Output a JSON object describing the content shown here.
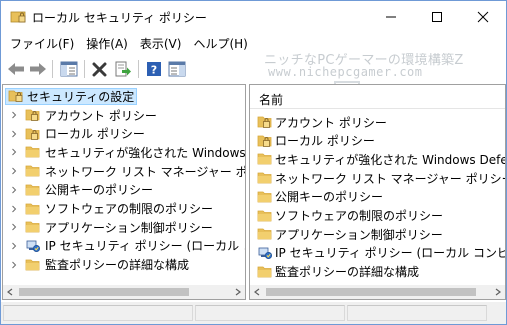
{
  "window": {
    "title": "ローカル セキュリティ ポリシー",
    "accent_color": "#6f9ad6"
  },
  "menu": {
    "items": [
      "ファイル(F)",
      "操作(A)",
      "表示(V)",
      "ヘルプ(H)"
    ]
  },
  "toolbar": {
    "buttons": [
      "back-arrow-icon",
      "forward-arrow-icon",
      "show-hide-console-tree-icon",
      "delete-icon",
      "export-list-icon",
      "help-icon",
      "show-action-pane-icon"
    ]
  },
  "watermark": {
    "line1": "ニッチなPCゲーマーの環境構築Z",
    "line2": "www.nichepcgamer.com"
  },
  "tree": {
    "root": "セキュリティの設定",
    "items": [
      {
        "label": "アカウント ポリシー",
        "icon": "locked-folder-icon"
      },
      {
        "label": "ローカル ポリシー",
        "icon": "locked-folder-icon"
      },
      {
        "label": "セキュリティが強化された Windows Defender",
        "icon": "folder-icon"
      },
      {
        "label": "ネットワーク リスト マネージャー ポリシー",
        "icon": "folder-icon"
      },
      {
        "label": "公開キーのポリシー",
        "icon": "folder-icon"
      },
      {
        "label": "ソフトウェアの制限のポリシー",
        "icon": "folder-icon"
      },
      {
        "label": "アプリケーション制御ポリシー",
        "icon": "folder-icon"
      },
      {
        "label": "IP セキュリティ ポリシー (ローカル コンピューター)",
        "icon": "ip-security-icon"
      },
      {
        "label": "監査ポリシーの詳細な構成",
        "icon": "folder-icon"
      }
    ]
  },
  "list": {
    "column_header": "名前",
    "items": [
      {
        "label": "アカウント ポリシー",
        "icon": "locked-folder-icon"
      },
      {
        "label": "ローカル ポリシー",
        "icon": "locked-folder-icon"
      },
      {
        "label": "セキュリティが強化された Windows Defender...",
        "icon": "folder-icon"
      },
      {
        "label": "ネットワーク リスト マネージャー ポリシー",
        "icon": "folder-icon"
      },
      {
        "label": "公開キーのポリシー",
        "icon": "folder-icon"
      },
      {
        "label": "ソフトウェアの制限のポリシー",
        "icon": "folder-icon"
      },
      {
        "label": "アプリケーション制御ポリシー",
        "icon": "folder-icon"
      },
      {
        "label": "IP セキュリティ ポリシー (ローカル コンピューター)",
        "icon": "ip-security-icon"
      },
      {
        "label": "監査ポリシーの詳細な構成",
        "icon": "folder-icon"
      }
    ]
  },
  "colors": {
    "folder": "#e8c05a",
    "folder_dark": "#d9a93b",
    "selection": "#cce8ff",
    "selection_border": "#99d1ff",
    "lock": "#8a6a2a"
  }
}
